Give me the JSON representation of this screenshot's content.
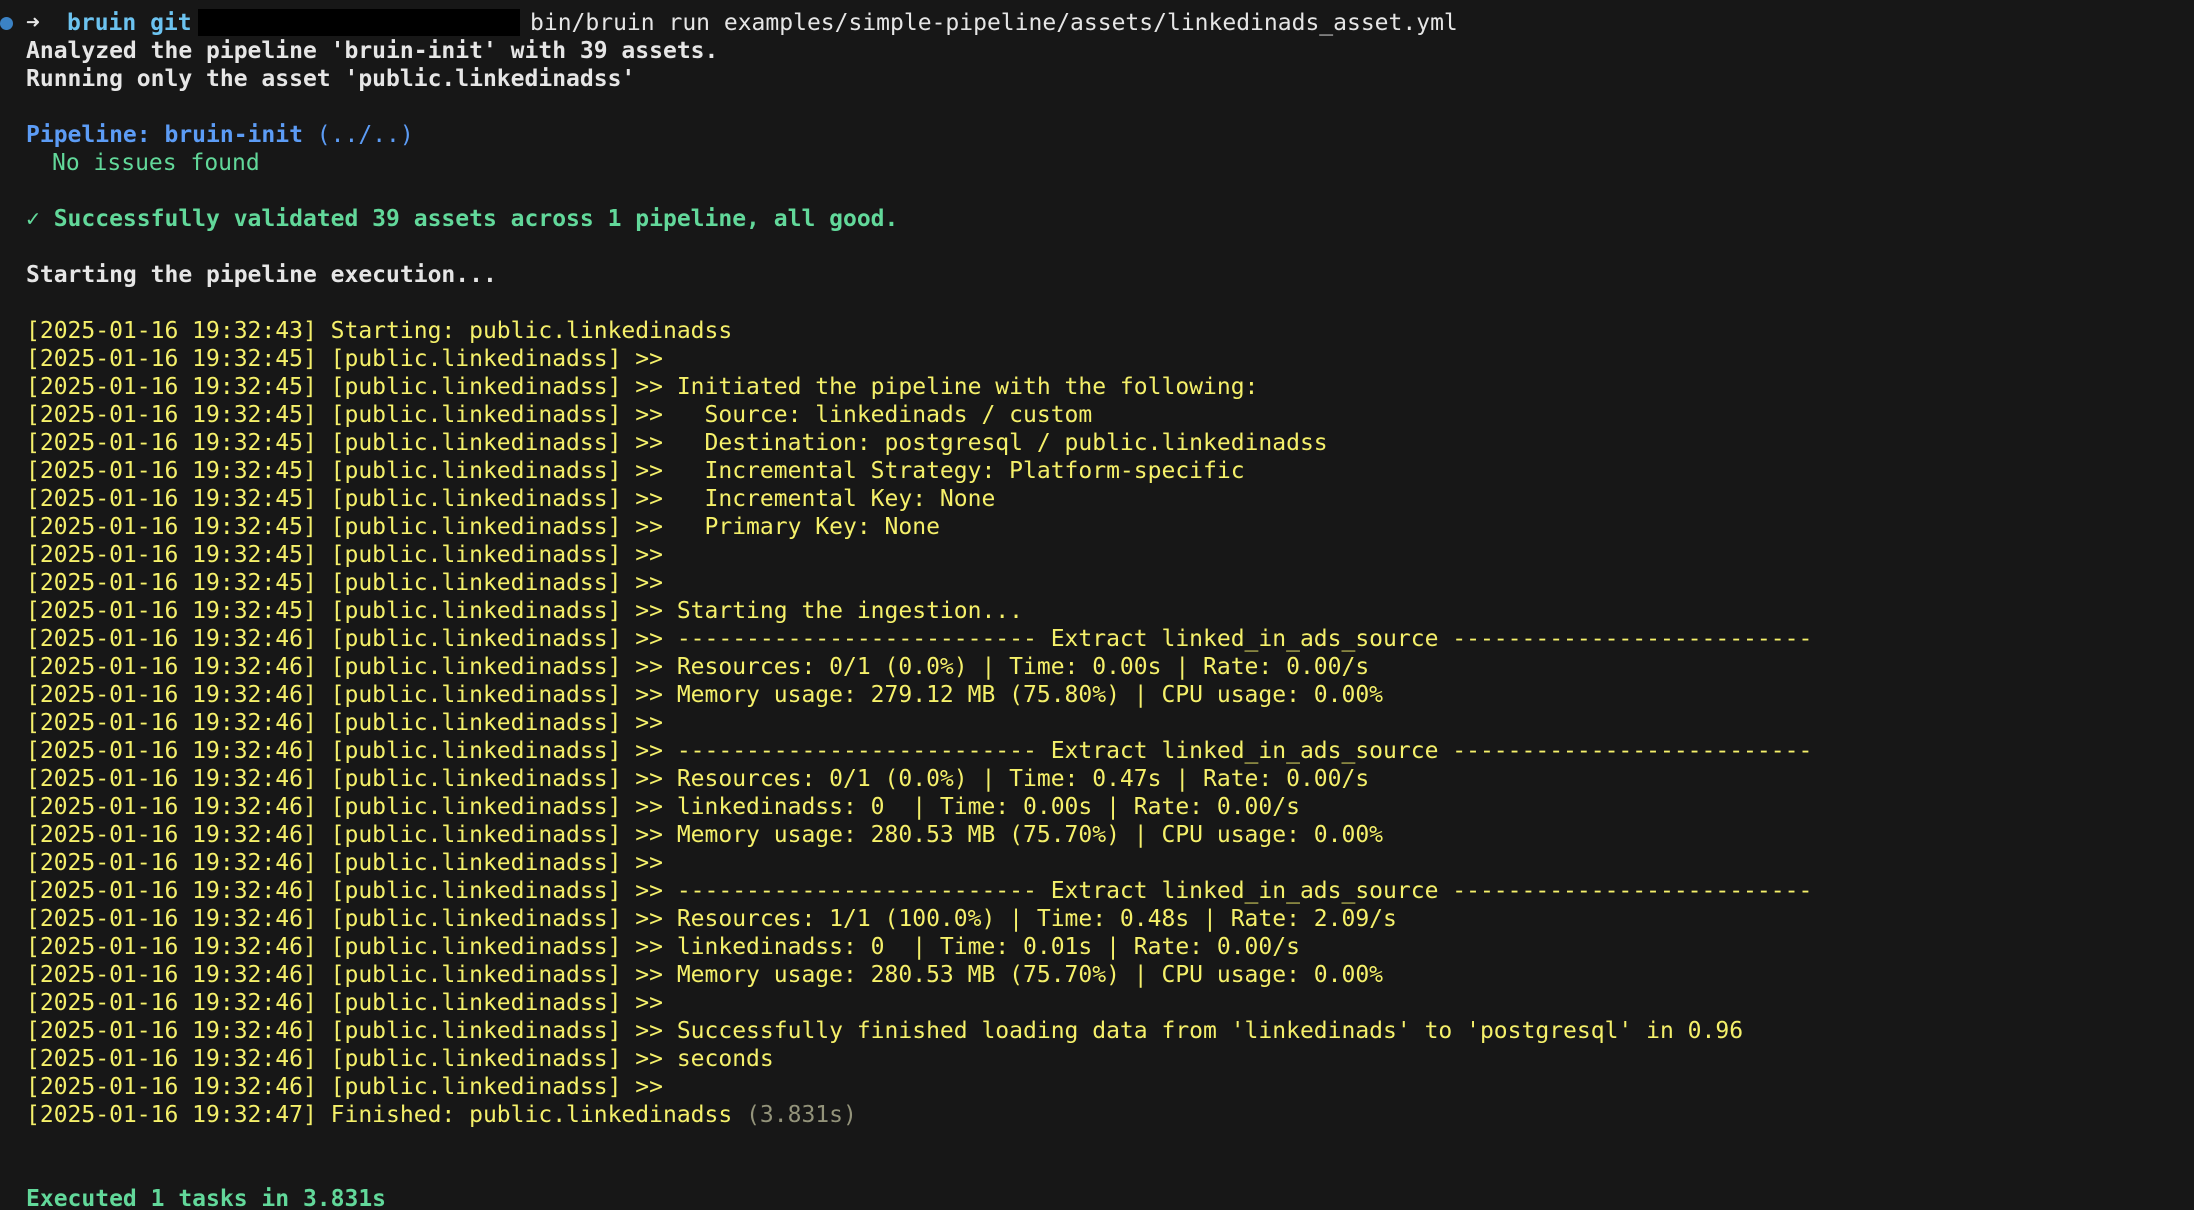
{
  "prompt": {
    "arrow": "➜",
    "directory": "bruin git",
    "command": "bin/bruin run examples/simple-pipeline/assets/linkedinads_asset.yml"
  },
  "header": {
    "analyzed": "Analyzed the pipeline 'bruin-init' with 39 assets.",
    "running_only": "Running only the asset 'public.linkedinadss'"
  },
  "pipeline": {
    "label": "Pipeline: bruin-init",
    "path": " (../..)",
    "issues": "No issues found",
    "validated": "✓ Successfully validated 39 assets across 1 pipeline, all good.",
    "starting": "Starting the pipeline execution..."
  },
  "log_lines": [
    {
      "ts": "[2025-01-16 19:32:43]",
      "msg": " Starting: public.linkedinadss"
    },
    {
      "ts": "[2025-01-16 19:32:45]",
      "msg": " [public.linkedinadss] >>"
    },
    {
      "ts": "[2025-01-16 19:32:45]",
      "msg": " [public.linkedinadss] >> Initiated the pipeline with the following:"
    },
    {
      "ts": "[2025-01-16 19:32:45]",
      "msg": " [public.linkedinadss] >>   Source: linkedinads / custom"
    },
    {
      "ts": "[2025-01-16 19:32:45]",
      "msg": " [public.linkedinadss] >>   Destination: postgresql / public.linkedinadss"
    },
    {
      "ts": "[2025-01-16 19:32:45]",
      "msg": " [public.linkedinadss] >>   Incremental Strategy: Platform-specific"
    },
    {
      "ts": "[2025-01-16 19:32:45]",
      "msg": " [public.linkedinadss] >>   Incremental Key: None"
    },
    {
      "ts": "[2025-01-16 19:32:45]",
      "msg": " [public.linkedinadss] >>   Primary Key: None"
    },
    {
      "ts": "[2025-01-16 19:32:45]",
      "msg": " [public.linkedinadss] >>"
    },
    {
      "ts": "[2025-01-16 19:32:45]",
      "msg": " [public.linkedinadss] >>"
    },
    {
      "ts": "[2025-01-16 19:32:45]",
      "msg": " [public.linkedinadss] >> Starting the ingestion..."
    },
    {
      "ts": "[2025-01-16 19:32:46]",
      "msg": " [public.linkedinadss] >> -------------------------- Extract linked_in_ads_source --------------------------"
    },
    {
      "ts": "[2025-01-16 19:32:46]",
      "msg": " [public.linkedinadss] >> Resources: 0/1 (0.0%) | Time: 0.00s | Rate: 0.00/s"
    },
    {
      "ts": "[2025-01-16 19:32:46]",
      "msg": " [public.linkedinadss] >> Memory usage: 279.12 MB (75.80%) | CPU usage: 0.00%"
    },
    {
      "ts": "[2025-01-16 19:32:46]",
      "msg": " [public.linkedinadss] >>"
    },
    {
      "ts": "[2025-01-16 19:32:46]",
      "msg": " [public.linkedinadss] >> -------------------------- Extract linked_in_ads_source --------------------------"
    },
    {
      "ts": "[2025-01-16 19:32:46]",
      "msg": " [public.linkedinadss] >> Resources: 0/1 (0.0%) | Time: 0.47s | Rate: 0.00/s"
    },
    {
      "ts": "[2025-01-16 19:32:46]",
      "msg": " [public.linkedinadss] >> linkedinadss: 0  | Time: 0.00s | Rate: 0.00/s"
    },
    {
      "ts": "[2025-01-16 19:32:46]",
      "msg": " [public.linkedinadss] >> Memory usage: 280.53 MB (75.70%) | CPU usage: 0.00%"
    },
    {
      "ts": "[2025-01-16 19:32:46]",
      "msg": " [public.linkedinadss] >>"
    },
    {
      "ts": "[2025-01-16 19:32:46]",
      "msg": " [public.linkedinadss] >> -------------------------- Extract linked_in_ads_source --------------------------"
    },
    {
      "ts": "[2025-01-16 19:32:46]",
      "msg": " [public.linkedinadss] >> Resources: 1/1 (100.0%) | Time: 0.48s | Rate: 2.09/s"
    },
    {
      "ts": "[2025-01-16 19:32:46]",
      "msg": " [public.linkedinadss] >> linkedinadss: 0  | Time: 0.01s | Rate: 0.00/s"
    },
    {
      "ts": "[2025-01-16 19:32:46]",
      "msg": " [public.linkedinadss] >> Memory usage: 280.53 MB (75.70%) | CPU usage: 0.00%"
    },
    {
      "ts": "[2025-01-16 19:32:46]",
      "msg": " [public.linkedinadss] >>"
    },
    {
      "ts": "[2025-01-16 19:32:46]",
      "msg": " [public.linkedinadss] >> Successfully finished loading data from 'linkedinads' to 'postgresql' in 0.96"
    },
    {
      "ts": "[2025-01-16 19:32:46]",
      "msg": " [public.linkedinadss] >> seconds"
    },
    {
      "ts": "[2025-01-16 19:32:46]",
      "msg": " [public.linkedinadss] >>"
    }
  ],
  "finished": {
    "ts": "[2025-01-16 19:32:47]",
    "msg": " Finished: public.linkedinadss",
    "duration": " (3.831s)"
  },
  "summary": "Executed 1 tasks in 3.831s",
  "colors": {
    "background": "#171717",
    "log_yellow": "#f5f06a",
    "success_green": "#62d89a",
    "pipeline_blue": "#5c9cf5"
  }
}
